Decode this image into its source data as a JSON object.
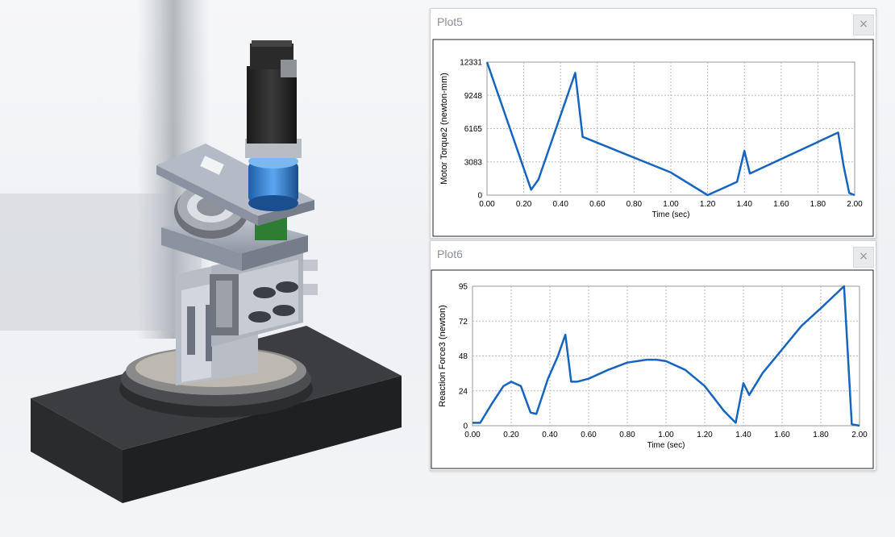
{
  "plots": [
    {
      "title": "Plot5",
      "close_label": "×",
      "chart_data": {
        "type": "line",
        "title": "",
        "xlabel": "Time (sec)",
        "ylabel": "Motor Torque2 (newton-mm)",
        "xlim": [
          0,
          2
        ],
        "ylim": [
          0,
          12331
        ],
        "xticks": [
          "0.00",
          "0.20",
          "0.40",
          "0.60",
          "0.80",
          "1.00",
          "1.20",
          "1.40",
          "1.60",
          "1.80",
          "2.00"
        ],
        "yticks": [
          "0",
          "3083",
          "6165",
          "9248",
          "12331"
        ],
        "grid": true,
        "series": [
          {
            "color": "#1565c0",
            "x": [
              0.0,
              0.24,
              0.28,
              0.48,
              0.52,
              1.0,
              1.2,
              1.36,
              1.4,
              1.43,
              1.91,
              1.94,
              1.97,
              2.0
            ],
            "y": [
              12331,
              500,
              1450,
              11330,
              5400,
              2100,
              0,
              1230,
              4100,
              2000,
              5800,
              2700,
              200,
              0
            ]
          }
        ]
      }
    },
    {
      "title": "Plot6",
      "close_label": "×",
      "chart_data": {
        "type": "line",
        "title": "",
        "xlabel": "Time (sec)",
        "ylabel": "Reaction Force3 (newton)",
        "xlim": [
          0,
          2
        ],
        "ylim": [
          0,
          95
        ],
        "xticks": [
          "0.00",
          "0.20",
          "0.40",
          "0.60",
          "0.80",
          "1.00",
          "1.20",
          "1.40",
          "1.60",
          "1.80",
          "2.00"
        ],
        "yticks": [
          "0",
          "24",
          "48",
          "72",
          "95"
        ],
        "grid": true,
        "series": [
          {
            "color": "#1565c0",
            "x": [
              0.0,
              0.04,
              0.1,
              0.16,
              0.2,
              0.25,
              0.3,
              0.33,
              0.36,
              0.39,
              0.44,
              0.48,
              0.51,
              0.54,
              0.6,
              0.7,
              0.8,
              0.9,
              0.95,
              1.0,
              1.1,
              1.2,
              1.3,
              1.36,
              1.4,
              1.43,
              1.5,
              1.6,
              1.7,
              1.8,
              1.92,
              1.96,
              2.0
            ],
            "y": [
              2,
              2,
              15,
              27,
              30,
              27,
              9,
              8,
              20,
              32,
              47,
              62,
              30,
              30,
              32,
              38,
              43,
              45,
              45,
              44,
              38,
              27,
              10,
              2,
              29,
              21,
              36,
              52,
              68,
              80,
              95,
              1,
              0
            ]
          }
        ]
      }
    }
  ]
}
